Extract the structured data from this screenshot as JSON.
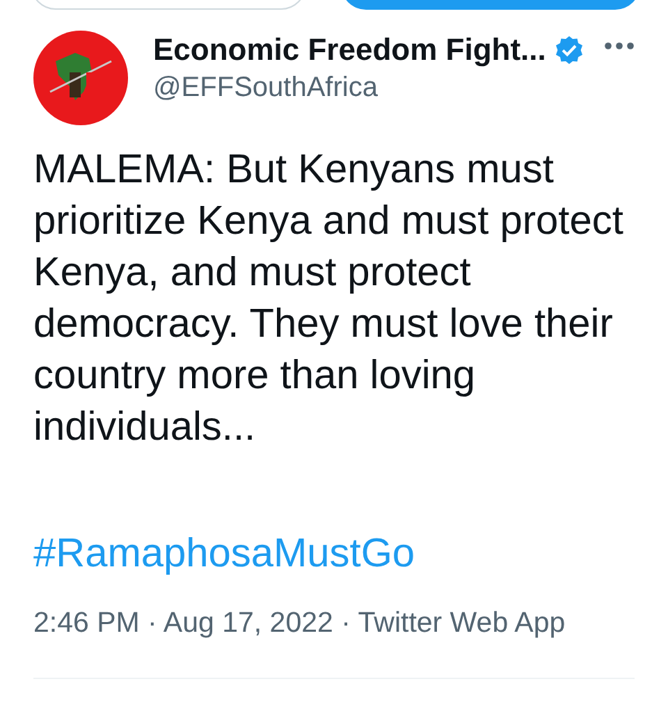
{
  "top_buttons": [
    {
      "kind": "outline"
    },
    {
      "kind": "filled"
    }
  ],
  "author": {
    "name": "Economic Freedom Fight...",
    "verified": true,
    "handle": "@EFFSouthAfrica"
  },
  "tweet": {
    "text": "MALEMA: But Kenyans must prioritize Kenya and must protect Kenya, and must protect democracy. They must love their country more than loving individuals...",
    "hashtag": "#RamaphosaMustGo",
    "meta": "2:46 PM · Aug 17, 2022 · Twitter Web App"
  }
}
